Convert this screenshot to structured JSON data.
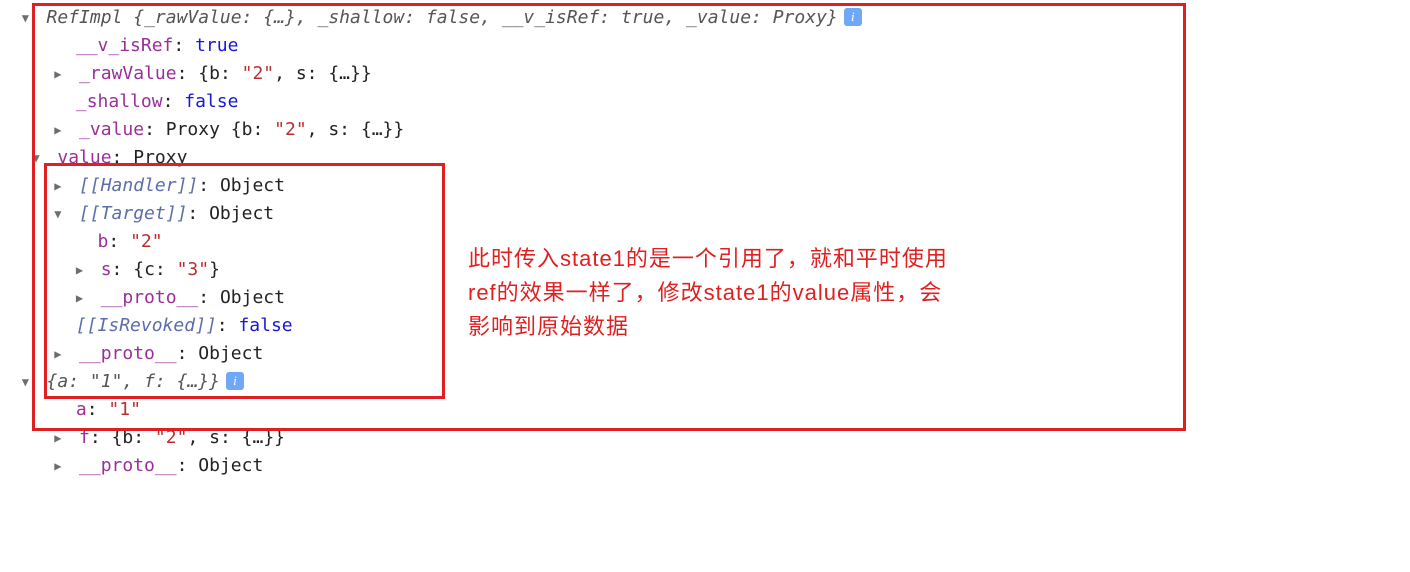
{
  "obj1": {
    "header_prefix": "RefImpl ",
    "header_brace_open": "{",
    "header_parts": {
      "p1_k": "_rawValue: ",
      "p1_v": "{…}",
      "sep1": ", ",
      "p2_k": "_shallow: ",
      "p2_v": "false",
      "sep2": ", ",
      "p3_k": "__v_isRef: ",
      "p3_v": "true",
      "sep3": ", ",
      "p4_k": "_value: ",
      "p4_v": "Proxy"
    },
    "header_brace_close": "}",
    "props": {
      "v_isRef_k": "__v_isRef",
      "v_isRef_v": "true",
      "rawValue_k": "_rawValue",
      "rawValue_v_pre": "{",
      "rawValue_v_b_k": "b: ",
      "rawValue_v_b_v": "\"2\"",
      "rawValue_v_sep": ", ",
      "rawValue_v_s_k": "s: ",
      "rawValue_v_s_v": "{…}",
      "rawValue_v_post": "}",
      "shallow_k": "_shallow",
      "shallow_v": "false",
      "value_k": "_value",
      "value_v_pre": "Proxy ",
      "value_v_open": "{",
      "value_v_b_k": "b: ",
      "value_v_b_v": "\"2\"",
      "value_v_sep": ", ",
      "value_v_s_k": "s: ",
      "value_v_s_v": "{…}",
      "value_v_close": "}"
    },
    "value_expanded": {
      "k": "value",
      "v": "Proxy",
      "handler_k": "[[Handler]]",
      "handler_v": "Object",
      "target_k": "[[Target]]",
      "target_v": "Object",
      "target_b_k": "b",
      "target_b_v": "\"2\"",
      "target_s_k": "s",
      "target_s_pre": "{",
      "target_s_c_k": "c: ",
      "target_s_c_v": "\"3\"",
      "target_s_post": "}",
      "target_proto_k": "__proto__",
      "target_proto_v": "Object",
      "isRevoked_k": "[[IsRevoked]]",
      "isRevoked_v": "false"
    },
    "proto_k": "__proto__",
    "proto_v": "Object"
  },
  "obj2": {
    "header_open": "{",
    "header_a_k": "a: ",
    "header_a_v": "\"1\"",
    "header_sep": ", ",
    "header_f_k": "f: ",
    "header_f_v": "{…}",
    "header_close": "}",
    "a_k": "a",
    "a_v": "\"1\"",
    "f_k": "f",
    "f_pre": "{",
    "f_b_k": "b: ",
    "f_b_v": "\"2\"",
    "f_sep": ", ",
    "f_s_k": "s: ",
    "f_s_v": "{…}",
    "f_post": "}",
    "proto_k": "__proto__",
    "proto_v": "Object"
  },
  "annotation": {
    "line1": "此时传入state1的是一个引用了，就和平时使用",
    "line2": "ref的效果一样了，修改state1的value属性，会",
    "line3": "影响到原始数据"
  },
  "info_badge": "i"
}
